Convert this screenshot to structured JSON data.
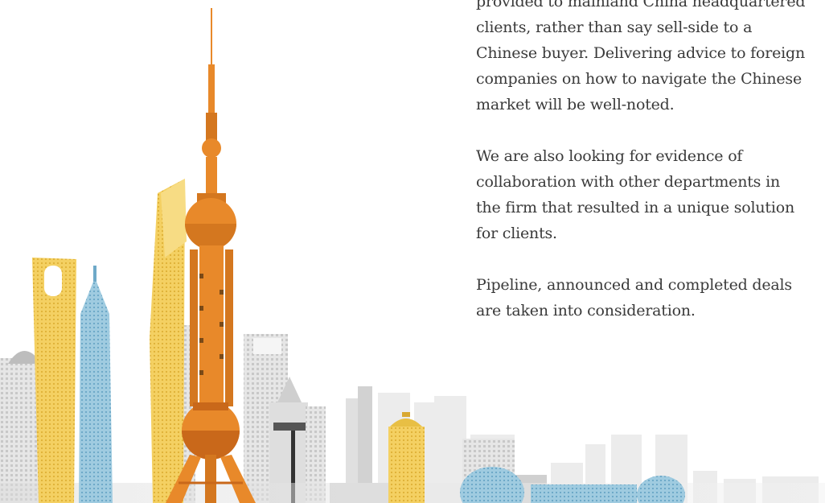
{
  "body": {
    "paragraphs": [
      "provided to mainland China headquartered clients, rather than say sell-side to a Chinese buyer. Delivering advice to foreign companies on how to navigate the Chinese market will be well-noted.",
      "We are also looking for evidence of collaboration with other departments in the firm that resulted in a unique solution for clients.",
      "Pipeline, announced and completed deals are taken into consideration."
    ]
  },
  "illustration": {
    "subject": "shanghai-skyline",
    "colors": {
      "tower": "#e8892a",
      "tower_dark": "#c9681a",
      "gold": "#f2c84b",
      "blue": "#8fc3dc",
      "grey": "#d9d9d9",
      "grey_dark": "#a9a9a9"
    }
  }
}
